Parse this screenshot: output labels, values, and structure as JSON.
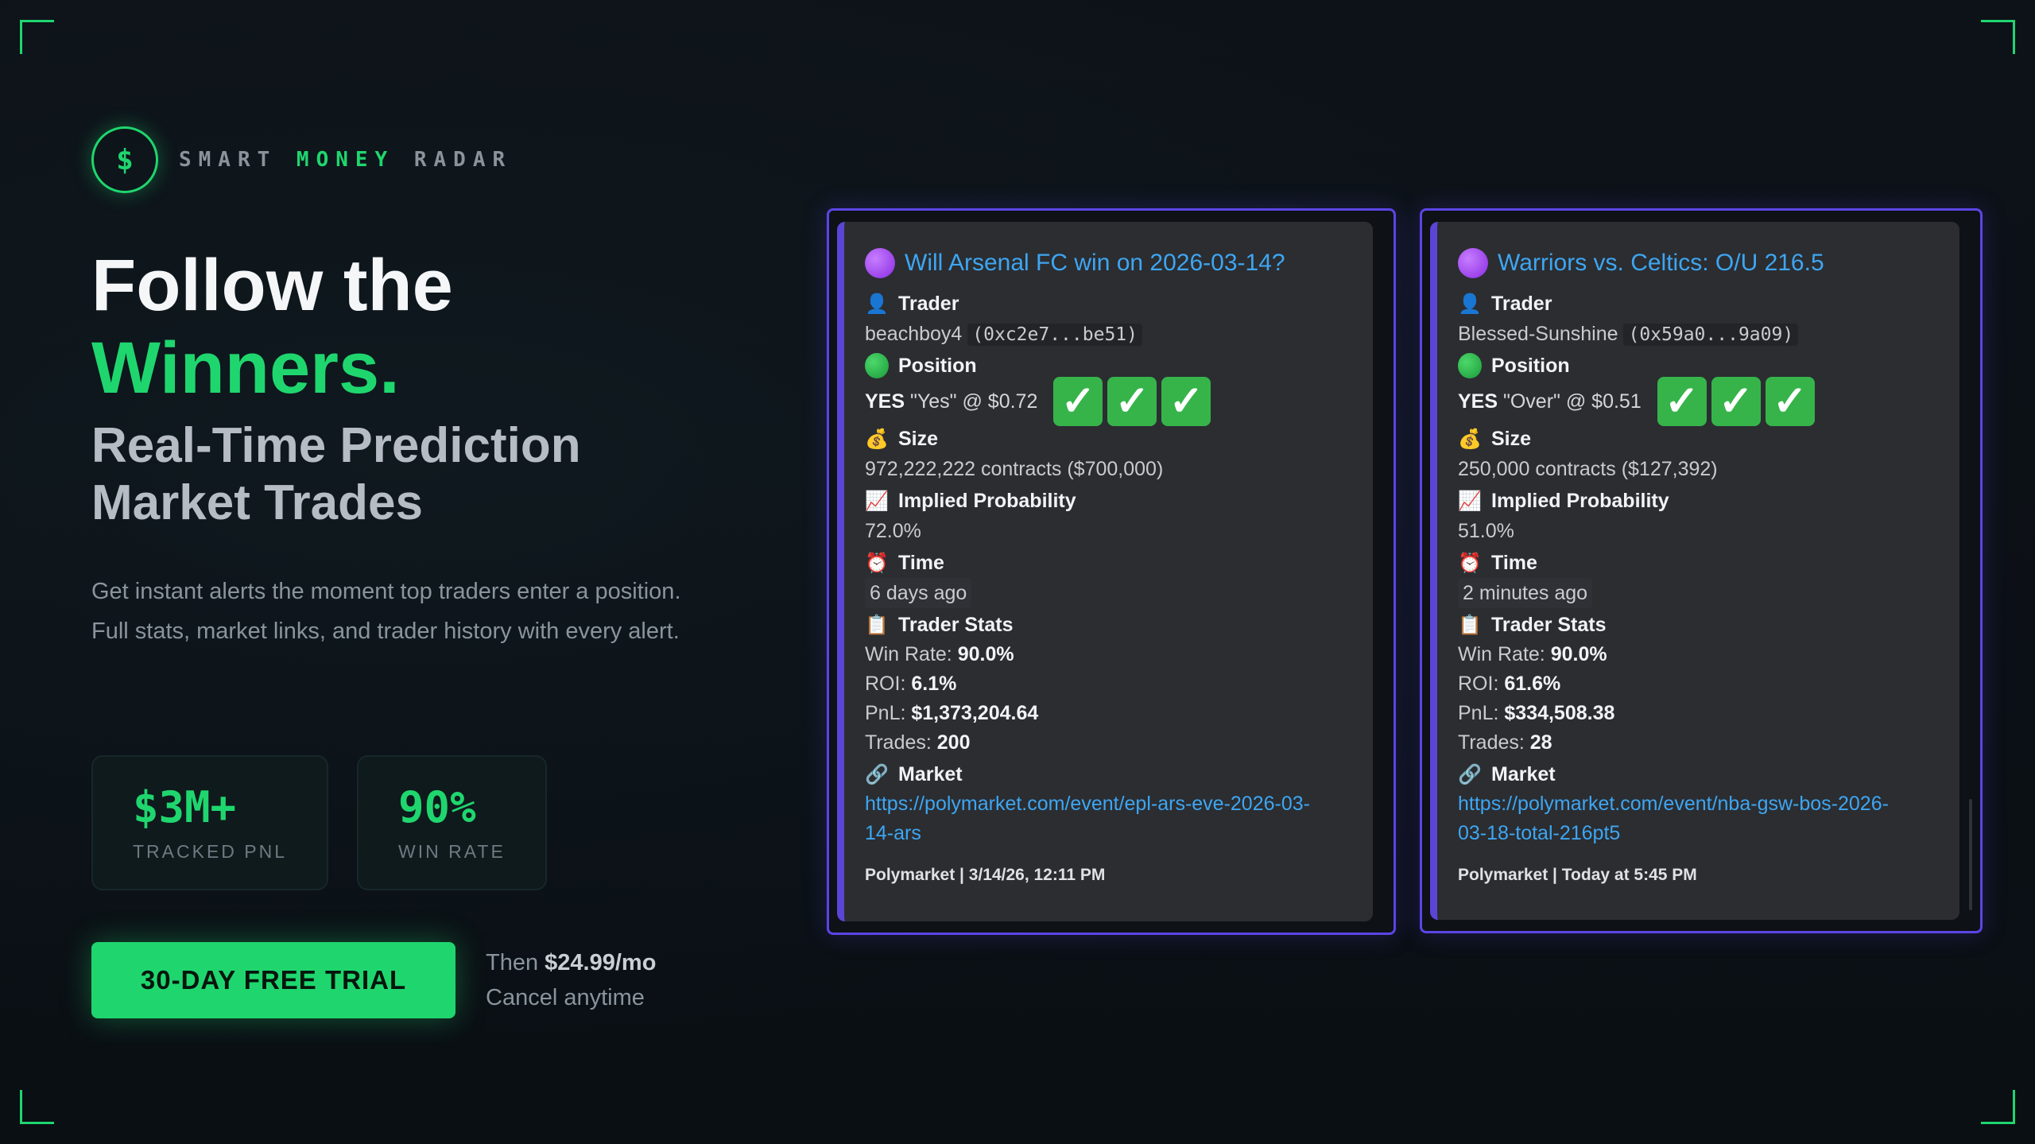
{
  "brand": {
    "logo_symbol": "$",
    "part1": "SMART ",
    "part2": "MONEY",
    "part3": " RADAR",
    "accent_color": "#1fd66e"
  },
  "hero": {
    "headline_line1": "Follow the",
    "headline_line2": "Winners.",
    "subheadline": "Real-Time Prediction Market Trades",
    "description": "Get instant alerts the moment top traders enter a position. Full stats, market links, and trader history with every alert."
  },
  "stats": [
    {
      "value": "$3M+",
      "label": "TRACKED PNL"
    },
    {
      "value": "90%",
      "label": "WIN RATE"
    }
  ],
  "cta": {
    "button_label": "30-DAY FREE TRIAL",
    "note_prefix": "Then ",
    "price": "$24.99/mo",
    "note_line2": "Cancel anytime"
  },
  "labels": {
    "trader": "Trader",
    "position": "Position",
    "size": "Size",
    "implied_probability": "Implied Probability",
    "time": "Time",
    "trader_stats": "Trader Stats",
    "market": "Market",
    "win_rate": "Win Rate: ",
    "roi": "ROI: ",
    "pnl": "PnL: ",
    "trades": "Trades: ",
    "check": "✓"
  },
  "cards": [
    {
      "title": "Will Arsenal FC win on 2026-03-14?",
      "trader_name": "beachboy4",
      "trader_address": "(0xc2e7...be51)",
      "position_side": "YES",
      "position_detail": "\"Yes\" @ $0.72",
      "size": "972,222,222 contracts ($700,000)",
      "implied_probability": "72.0%",
      "time": "6 days ago",
      "win_rate": "90.0%",
      "roi": "6.1%",
      "pnl": "$1,373,204.64",
      "trades": "200",
      "market_url": "https://polymarket.com/event/epl-ars-eve-2026-03-14-ars",
      "footer": "Polymarket | 3/14/26, 12:11 PM"
    },
    {
      "title": "Warriors vs. Celtics: O/U 216.5",
      "trader_name": "Blessed-Sunshine",
      "trader_address": "(0x59a0...9a09)",
      "position_side": "YES",
      "position_detail": "\"Over\" @ $0.51",
      "size": "250,000 contracts ($127,392)",
      "implied_probability": "51.0%",
      "time": "2 minutes ago",
      "win_rate": "90.0%",
      "roi": "61.6%",
      "pnl": "$334,508.38",
      "trades": "28",
      "market_url": "https://polymarket.com/event/nba-gsw-bos-2026-03-18-total-216pt5",
      "footer": "Polymarket | Today at 5:45 PM"
    }
  ]
}
